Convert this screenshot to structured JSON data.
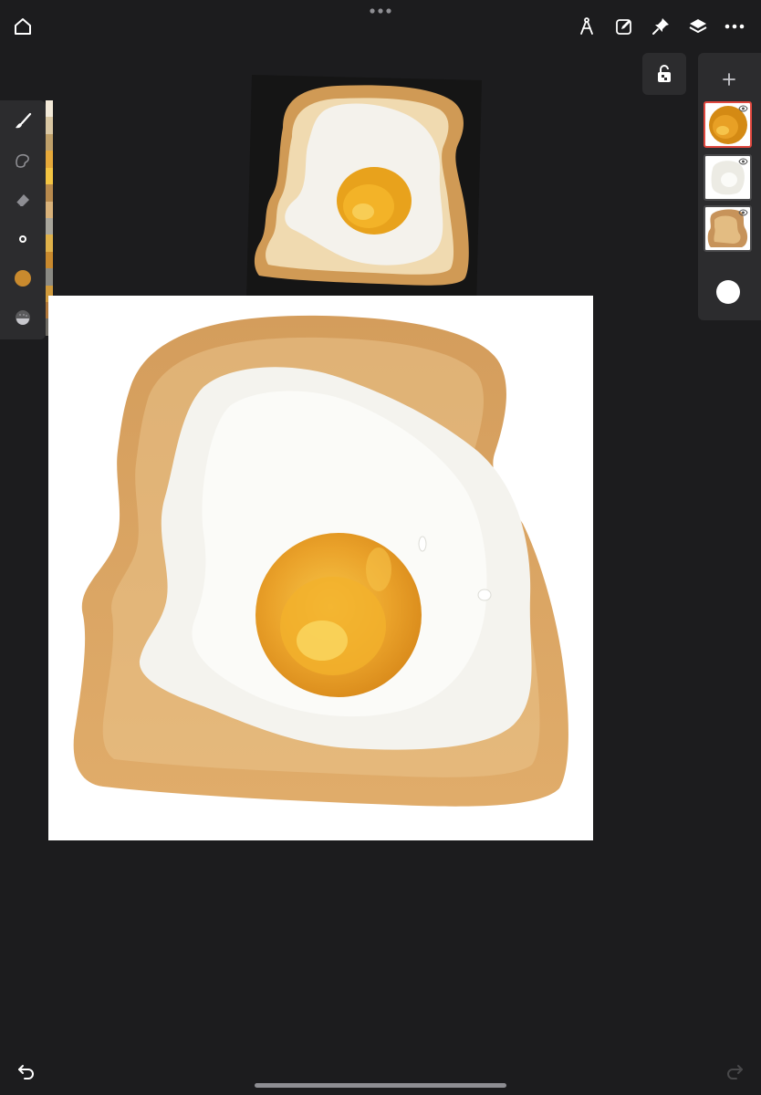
{
  "app": {
    "name": ""
  },
  "colors": {
    "background": "#1c1c1e",
    "panel": "#2c2c2e",
    "active_color": "#c98a2e",
    "selected_layer_border": "#e0483f",
    "canvas": "#ffffff"
  },
  "top_toolbar": {
    "left": [
      "home-icon"
    ],
    "center": [
      "more-dots-icon"
    ],
    "right": [
      "symmetry-icon",
      "edit-icon",
      "pin-icon",
      "layers-icon",
      "more-icon"
    ]
  },
  "left_toolbar": {
    "tools": [
      "brush-icon",
      "smudge-icon",
      "eraser-icon",
      "brush-size-icon",
      "color-icon",
      "opacity-icon"
    ],
    "palette_swatches": [
      "#f2e9d8",
      "#d9c7a3",
      "#bfa06a",
      "#e6a93a",
      "#f3c442",
      "#b88a4d",
      "#d9b27a",
      "#a8a69c",
      "#e0b24a",
      "#c98a2e",
      "#8a8a84",
      "#d09a3c",
      "#b0773a",
      "#6d6a63"
    ]
  },
  "layers": [
    {
      "name": "layer-1",
      "thumb": "yolk",
      "selected": true,
      "visible": true
    },
    {
      "name": "layer-2",
      "thumb": "egg-white",
      "selected": false,
      "visible": true
    },
    {
      "name": "layer-3",
      "thumb": "toast",
      "selected": false,
      "visible": true
    }
  ],
  "bottom": {
    "undo": "undo-icon",
    "redo": "redo-icon"
  }
}
